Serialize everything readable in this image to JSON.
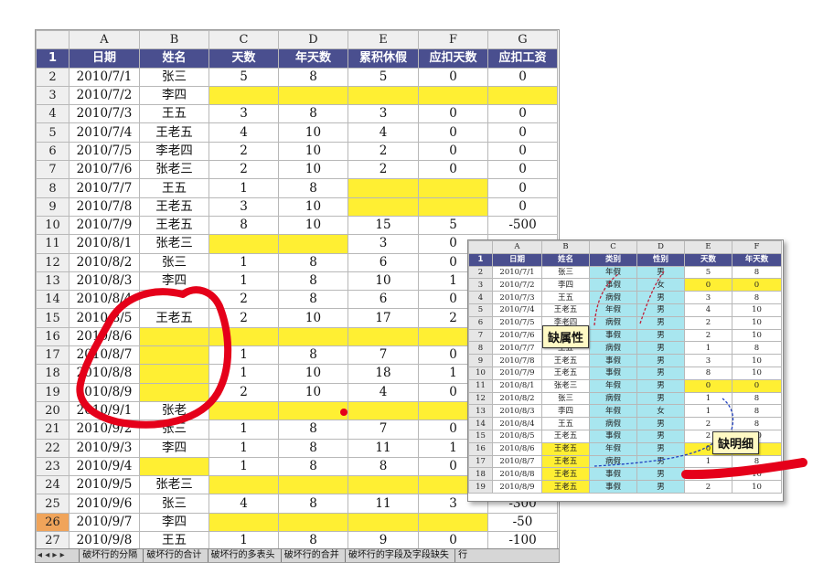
{
  "main_sheet": {
    "columns": [
      "A",
      "B",
      "C",
      "D",
      "E",
      "F",
      "G"
    ],
    "header": [
      "日期",
      "姓名",
      "天数",
      "年天数",
      "累积休假",
      "应扣天数",
      "应扣工资"
    ],
    "rows": [
      {
        "n": "2",
        "c": [
          "2010/7/1",
          "张三",
          "5",
          "8",
          "5",
          "0",
          "0"
        ],
        "y": []
      },
      {
        "n": "3",
        "c": [
          "2010/7/2",
          "李四",
          "",
          "",
          "",
          "",
          ""
        ],
        "y": [
          2,
          3,
          4,
          5,
          6
        ]
      },
      {
        "n": "4",
        "c": [
          "2010/7/3",
          "王五",
          "3",
          "8",
          "3",
          "0",
          "0"
        ],
        "y": []
      },
      {
        "n": "5",
        "c": [
          "2010/7/4",
          "王老五",
          "4",
          "10",
          "4",
          "0",
          "0"
        ],
        "y": []
      },
      {
        "n": "6",
        "c": [
          "2010/7/5",
          "李老四",
          "2",
          "10",
          "2",
          "0",
          "0"
        ],
        "y": []
      },
      {
        "n": "7",
        "c": [
          "2010/7/6",
          "张老三",
          "2",
          "10",
          "2",
          "0",
          "0"
        ],
        "y": []
      },
      {
        "n": "8",
        "c": [
          "2010/7/7",
          "王五",
          "1",
          "8",
          "",
          "",
          "0"
        ],
        "y": [
          4,
          5
        ]
      },
      {
        "n": "9",
        "c": [
          "2010/7/8",
          "王老五",
          "3",
          "10",
          "",
          "",
          "0"
        ],
        "y": [
          4,
          5
        ]
      },
      {
        "n": "10",
        "c": [
          "2010/7/9",
          "王老五",
          "8",
          "10",
          "15",
          "5",
          "-500"
        ],
        "y": []
      },
      {
        "n": "11",
        "c": [
          "2010/8/1",
          "张老三",
          "",
          "",
          "3",
          "0",
          ""
        ],
        "y": [
          2,
          3
        ]
      },
      {
        "n": "12",
        "c": [
          "2010/8/2",
          "张三",
          "1",
          "8",
          "6",
          "0",
          ""
        ],
        "y": []
      },
      {
        "n": "13",
        "c": [
          "2010/8/3",
          "李四",
          "1",
          "8",
          "10",
          "1",
          ""
        ],
        "y": []
      },
      {
        "n": "14",
        "c": [
          "2010/8/4",
          "",
          "2",
          "8",
          "6",
          "0",
          ""
        ],
        "y": []
      },
      {
        "n": "15",
        "c": [
          "2010/8/5",
          "王老五",
          "2",
          "10",
          "17",
          "2",
          ""
        ],
        "y": []
      },
      {
        "n": "16",
        "c": [
          "2010/8/6",
          "",
          "",
          "",
          "",
          "",
          ""
        ],
        "y": [
          1,
          2,
          3,
          4,
          5
        ]
      },
      {
        "n": "17",
        "c": [
          "2010/8/7",
          "",
          "1",
          "8",
          "7",
          "0",
          ""
        ],
        "y": [
          1
        ]
      },
      {
        "n": "18",
        "c": [
          "2010/8/8",
          "",
          "1",
          "10",
          "18",
          "1",
          ""
        ],
        "y": [
          1
        ]
      },
      {
        "n": "19",
        "c": [
          "2010/8/9",
          "",
          "2",
          "10",
          "4",
          "0",
          ""
        ],
        "y": [
          1
        ]
      },
      {
        "n": "20",
        "c": [
          "2010/9/1",
          "张老",
          "",
          "",
          "",
          "",
          ""
        ],
        "y": [
          2,
          3,
          4,
          5
        ]
      },
      {
        "n": "21",
        "c": [
          "2010/9/2",
          "张三",
          "1",
          "8",
          "7",
          "0",
          ""
        ],
        "y": []
      },
      {
        "n": "22",
        "c": [
          "2010/9/3",
          "李四",
          "1",
          "8",
          "11",
          "1",
          ""
        ],
        "y": []
      },
      {
        "n": "23",
        "c": [
          "2010/9/4",
          "",
          "1",
          "8",
          "8",
          "0",
          ""
        ],
        "y": [
          1
        ]
      },
      {
        "n": "24",
        "c": [
          "2010/9/5",
          "张老三",
          "",
          "",
          "",
          "",
          ""
        ],
        "y": [
          2,
          3,
          4,
          5
        ]
      },
      {
        "n": "25",
        "c": [
          "2010/9/6",
          "张三",
          "4",
          "8",
          "11",
          "3",
          "-300"
        ],
        "y": []
      },
      {
        "n": "26",
        "c": [
          "2010/9/7",
          "李四",
          "",
          "",
          "",
          "",
          "-50"
        ],
        "y": [
          2,
          3,
          4,
          5
        ],
        "sel": true
      },
      {
        "n": "27",
        "c": [
          "2010/9/8",
          "王五",
          "1",
          "8",
          "9",
          "0",
          "-100"
        ],
        "y": []
      }
    ]
  },
  "sheet_tabs": {
    "nav": "◂ ◂ ▸ ▸",
    "tabs": [
      "破坏行的分隔",
      "破坏行的合计",
      "破坏行的多表头",
      "破坏行的合并",
      "破坏行的字段及字段缺失",
      "行"
    ]
  },
  "inset_sheet": {
    "columns": [
      "A",
      "B",
      "C",
      "D",
      "E",
      "F"
    ],
    "header": [
      "日期",
      "姓名",
      "类别",
      "性别",
      "天数",
      "年天数"
    ],
    "rows": [
      {
        "n": "2",
        "c": [
          "2010/7/1",
          "张三",
          "年假",
          "男",
          "5",
          "8"
        ],
        "y": []
      },
      {
        "n": "3",
        "c": [
          "2010/7/2",
          "李四",
          "事假",
          "女",
          "0",
          "0"
        ],
        "y": [
          4,
          5
        ]
      },
      {
        "n": "4",
        "c": [
          "2010/7/3",
          "王五",
          "病假",
          "男",
          "3",
          "8"
        ],
        "y": []
      },
      {
        "n": "5",
        "c": [
          "2010/7/4",
          "王老五",
          "年假",
          "男",
          "4",
          "10"
        ],
        "y": []
      },
      {
        "n": "6",
        "c": [
          "2010/7/5",
          "李老四",
          "病假",
          "男",
          "2",
          "10"
        ],
        "y": []
      },
      {
        "n": "7",
        "c": [
          "2010/7/6",
          "张老三",
          "事假",
          "男",
          "2",
          "10"
        ],
        "y": []
      },
      {
        "n": "8",
        "c": [
          "2010/7/7",
          "王五",
          "病假",
          "男",
          "1",
          "8"
        ],
        "y": []
      },
      {
        "n": "9",
        "c": [
          "2010/7/8",
          "王老五",
          "事假",
          "男",
          "3",
          "10"
        ],
        "y": []
      },
      {
        "n": "10",
        "c": [
          "2010/7/9",
          "王老五",
          "事假",
          "男",
          "8",
          "10"
        ],
        "y": []
      },
      {
        "n": "11",
        "c": [
          "2010/8/1",
          "张老三",
          "年假",
          "男",
          "0",
          "0"
        ],
        "y": [
          4,
          5
        ]
      },
      {
        "n": "12",
        "c": [
          "2010/8/2",
          "张三",
          "病假",
          "男",
          "1",
          "8"
        ],
        "y": []
      },
      {
        "n": "13",
        "c": [
          "2010/8/3",
          "李四",
          "年假",
          "女",
          "1",
          "8"
        ],
        "y": []
      },
      {
        "n": "14",
        "c": [
          "2010/8/4",
          "王五",
          "病假",
          "男",
          "2",
          "8"
        ],
        "y": []
      },
      {
        "n": "15",
        "c": [
          "2010/8/5",
          "王老五",
          "事假",
          "男",
          "2",
          "10"
        ],
        "y": []
      },
      {
        "n": "16",
        "c": [
          "2010/8/6",
          "王老五",
          "年假",
          "男",
          "0",
          "0"
        ],
        "y": [
          1,
          4,
          5
        ]
      },
      {
        "n": "17",
        "c": [
          "2010/8/7",
          "王老五",
          "病假",
          "男",
          "1",
          "8"
        ],
        "y": [
          1
        ]
      },
      {
        "n": "18",
        "c": [
          "2010/8/8",
          "王老五",
          "事假",
          "男",
          "1",
          "10"
        ],
        "y": [
          1
        ]
      },
      {
        "n": "19",
        "c": [
          "2010/8/9",
          "王老五",
          "事假",
          "男",
          "2",
          "10"
        ],
        "y": [
          1
        ]
      }
    ]
  },
  "callouts": {
    "missing_attribute": "缺属性",
    "missing_detail": "缺明细"
  },
  "colors": {
    "header_bg": "#4a4f8f",
    "missing_fill": "#ffef33",
    "attribute_fill": "#a8e6ef",
    "annotation_red": "#e5001a",
    "selected_row": "#f0a45a"
  }
}
